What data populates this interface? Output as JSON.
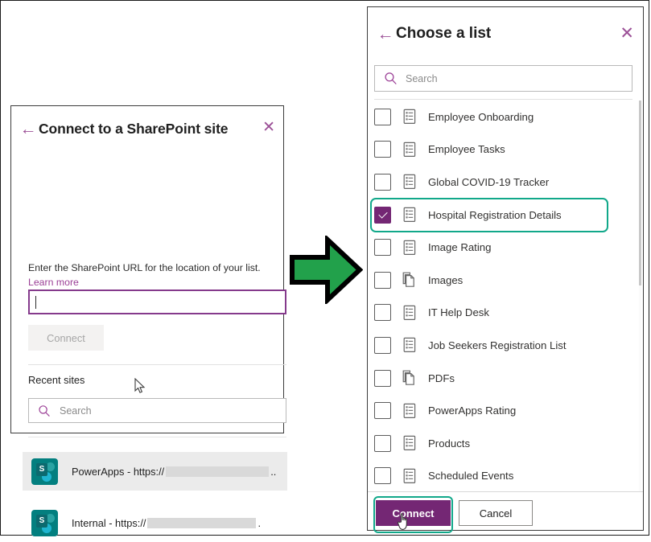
{
  "left_panel": {
    "back_icon": "back-arrow-icon",
    "title": "Connect to a SharePoint site",
    "close_icon": "close-icon",
    "description": "Enter the SharePoint URL for the location of your list.",
    "learn_more": "Learn more",
    "url_input_value": "",
    "url_input_placeholder": "",
    "connect_button": "Connect",
    "connect_button_state": "disabled",
    "recent_sites_label": "Recent sites",
    "search_placeholder": "Search",
    "search_value": "",
    "search_icon": "search-icon",
    "sites": [
      {
        "label": "PowerApps - https://",
        "trailing": "..",
        "icon": "sharepoint-icon",
        "redacted": true,
        "hovered": true
      },
      {
        "label": "Internal - https://",
        "trailing": ".",
        "icon": "sharepoint-icon",
        "redacted": true,
        "hovered": false
      }
    ]
  },
  "arrow": {
    "icon": "right-arrow-icon",
    "fill_color": "#22a14b",
    "stroke_color": "#000000"
  },
  "right_panel": {
    "back_icon": "back-arrow-icon",
    "title": "Choose a list",
    "close_icon": "close-icon",
    "search_placeholder": "Search",
    "search_value": "",
    "search_icon": "search-icon",
    "highlight_color": "#11a88a",
    "accent_color": "#742774",
    "lists": [
      {
        "label": "Employee Onboarding",
        "icon": "list-icon",
        "checked": false
      },
      {
        "label": "Employee Tasks",
        "icon": "list-icon",
        "checked": false
      },
      {
        "label": "Global COVID-19 Tracker",
        "icon": "list-icon",
        "checked": false
      },
      {
        "label": "Hospital Registration Details",
        "icon": "list-icon",
        "checked": true
      },
      {
        "label": "Image Rating",
        "icon": "list-icon",
        "checked": false
      },
      {
        "label": "Images",
        "icon": "library-icon",
        "checked": false
      },
      {
        "label": "IT Help Desk",
        "icon": "list-icon",
        "checked": false
      },
      {
        "label": "Job Seekers Registration List",
        "icon": "list-icon",
        "checked": false
      },
      {
        "label": "PDFs",
        "icon": "library-icon",
        "checked": false
      },
      {
        "label": "PowerApps Rating",
        "icon": "list-icon",
        "checked": false
      },
      {
        "label": "Products",
        "icon": "list-icon",
        "checked": false
      },
      {
        "label": "Scheduled Events",
        "icon": "list-icon",
        "checked": false
      }
    ],
    "connect_button": "Connect",
    "cancel_button": "Cancel"
  }
}
